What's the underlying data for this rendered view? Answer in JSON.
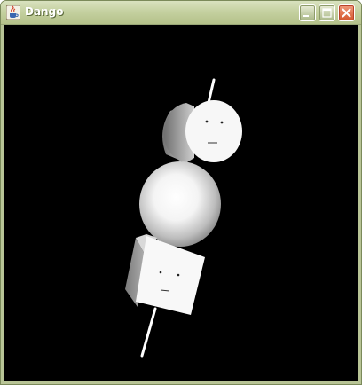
{
  "window": {
    "title": "Dango",
    "icon": "java-cup-icon",
    "controls": {
      "minimize_icon": "minimize-icon",
      "maximize_icon": "maximize-icon",
      "close_icon": "close-icon"
    },
    "chrome_color": "#b8c496",
    "close_color": "#d4562c"
  },
  "scene": {
    "background": "#000000",
    "objects": [
      {
        "shape": "cylinder",
        "face": "face-icon",
        "color": "#ffffff"
      },
      {
        "shape": "sphere",
        "color": "#ffffff"
      },
      {
        "shape": "cube",
        "face": "face-icon",
        "color": "#ffffff"
      }
    ],
    "skewer": {
      "color": "#ffffff"
    }
  }
}
